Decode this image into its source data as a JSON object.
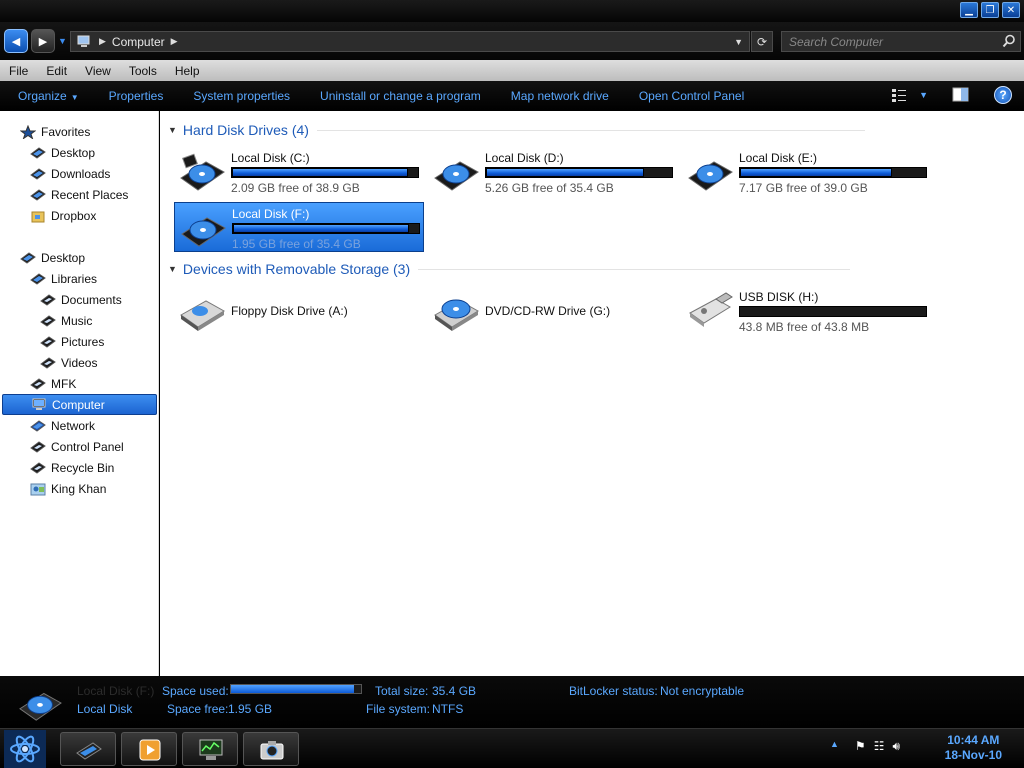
{
  "window": {
    "minimize": "▁",
    "maximize": "❐",
    "close": "✕"
  },
  "address": {
    "crumb": "Computer",
    "search_placeholder": "Search Computer"
  },
  "menu": [
    "File",
    "Edit",
    "View",
    "Tools",
    "Help"
  ],
  "commands": [
    "Organize",
    "Properties",
    "System properties",
    "Uninstall or change a program",
    "Map network drive",
    "Open Control Panel"
  ],
  "nav": {
    "favorites": "Favorites",
    "fav_items": [
      "Desktop",
      "Downloads",
      "Recent Places",
      "Dropbox"
    ],
    "desktop": "Desktop",
    "libraries": "Libraries",
    "lib_items": [
      "Documents",
      "Music",
      "Pictures",
      "Videos"
    ],
    "other": [
      "MFK",
      "Computer",
      "Network",
      "Control Panel",
      "Recycle Bin",
      "King Khan"
    ]
  },
  "groups": {
    "hdd": "Hard Disk Drives (4)",
    "removable": "Devices with Removable Storage (3)"
  },
  "drives": [
    {
      "name": "Local Disk (C:)",
      "free": "2.09 GB free of 38.9 GB",
      "used_fraction": 0.946
    },
    {
      "name": "Local Disk (D:)",
      "free": "5.26 GB free of 35.4 GB",
      "used_fraction": 0.851
    },
    {
      "name": "Local Disk (E:)",
      "free": "7.17 GB free of 39.0 GB",
      "used_fraction": 0.816
    },
    {
      "name": "Local Disk (F:)",
      "free": "1.95 GB free of 35.4 GB",
      "used_fraction": 0.945
    }
  ],
  "removable": [
    {
      "name": "Floppy Disk Drive (A:)"
    },
    {
      "name": "DVD/CD-RW Drive (G:)"
    },
    {
      "name": "USB DISK (H:)",
      "free": "43.8 MB free of 43.8 MB",
      "used_fraction": 0.0
    }
  ],
  "details": {
    "ghost_name": "Local Disk (F:)",
    "type": "Local Disk",
    "space_used_label": "Space used:",
    "space_free_label": "Space free:",
    "space_free_value": "1.95 GB",
    "total_size_label": "Total size:",
    "total_size_value": "35.4 GB",
    "file_system_label": "File system:",
    "file_system_value": "NTFS",
    "bitlocker_label": "BitLocker status:",
    "bitlocker_value": "Not encryptable",
    "used_fraction": 0.945
  },
  "clock": {
    "time": "10:44 AM",
    "date": "18-Nov-10"
  },
  "colors": {
    "accent": "#5aa8ff",
    "header": "#1e5bb8",
    "bar_fill": "#1a6bd8"
  }
}
